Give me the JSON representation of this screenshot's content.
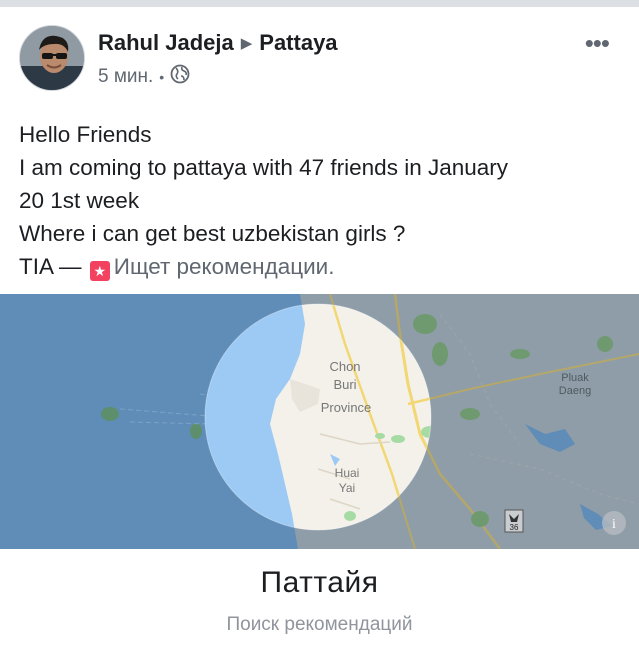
{
  "post": {
    "author": "Rahul Jadeja",
    "location": "Pattaya",
    "time": "5 мин.",
    "meta_separator": "•",
    "text_lines": [
      "Hello Friends",
      "I am coming to pattaya with 47  friends in January",
      "20 1st week",
      "Where i can get best uzbekistan girls ?"
    ],
    "last_line_prefix": "TIA —",
    "recommendation_status": "Ищет рекомендации."
  },
  "map": {
    "labels": {
      "chon": "Chon",
      "buri": "Buri",
      "province": "Province",
      "huai": "Huai",
      "yai": "Yai",
      "pluak": "Pluak",
      "daeng": "Daeng",
      "route": "36",
      "info": "i"
    },
    "colors": {
      "sea": "#5f8db8",
      "land": "#8e9da7",
      "highlight_sea": "#9ccaf5",
      "highlight_land": "#f4f1ea"
    }
  },
  "place": {
    "name": "Паттайя",
    "subtitle": "Поиск рекомендаций"
  },
  "icons": {
    "globe": "globe-icon",
    "more": "more-options-icon",
    "recommendation": "recommendation-badge-icon",
    "info": "map-info-icon"
  }
}
